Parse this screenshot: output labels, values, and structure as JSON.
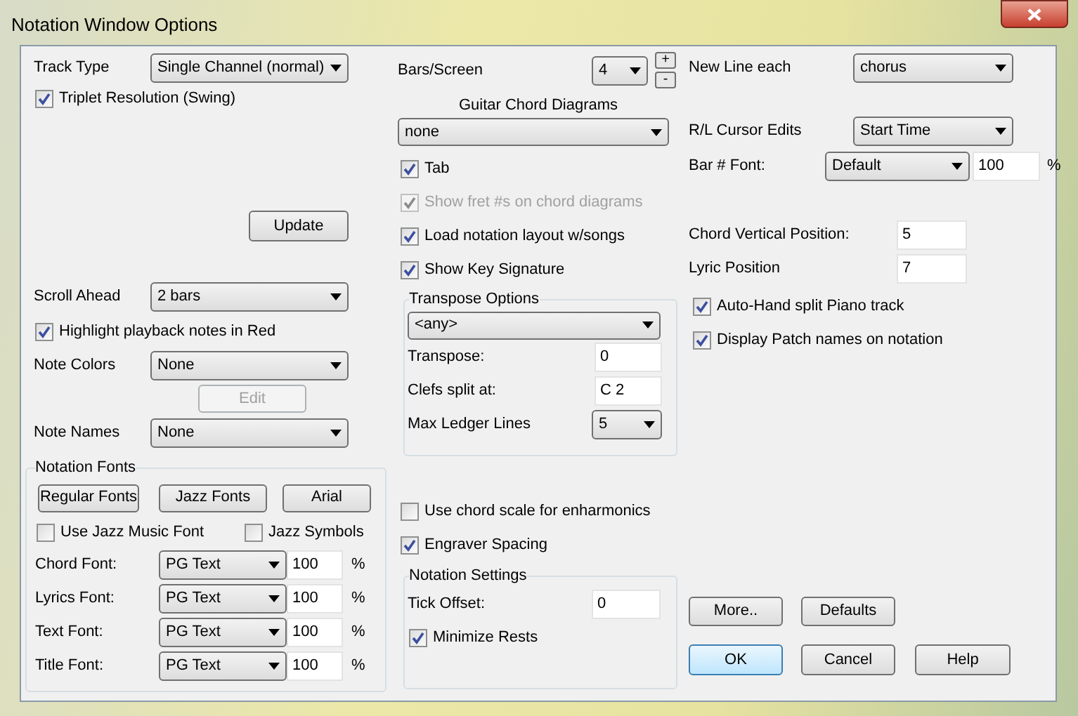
{
  "window": {
    "title": "Notation Window Options"
  },
  "track_type": {
    "label": "Track Type",
    "value": "Single Channel (normal)"
  },
  "triplet_resolution": {
    "label": "Triplet Resolution (Swing)",
    "checked": true
  },
  "update_button": "Update",
  "scroll_ahead": {
    "label": "Scroll Ahead",
    "value": "2 bars"
  },
  "highlight_playback": {
    "label": "Highlight playback notes in Red",
    "checked": true
  },
  "note_colors": {
    "label": "Note Colors",
    "value": "None"
  },
  "edit_button": {
    "label": "Edit",
    "disabled": true
  },
  "note_names": {
    "label": "Note Names",
    "value": "None"
  },
  "notation_fonts": {
    "title": "Notation Fonts",
    "buttons": [
      "Regular Fonts",
      "Jazz Fonts",
      "Arial"
    ],
    "use_jazz_music_font": {
      "label": "Use Jazz Music Font",
      "checked": false
    },
    "jazz_symbols": {
      "label": "Jazz Symbols",
      "checked": false
    },
    "fonts": [
      {
        "label": "Chord Font:",
        "value": "PG Text",
        "size": "100",
        "unit": "%"
      },
      {
        "label": "Lyrics Font:",
        "value": "PG Text",
        "size": "100",
        "unit": "%"
      },
      {
        "label": "Text Font:",
        "value": "PG Text",
        "size": "100",
        "unit": "%"
      },
      {
        "label": "Title Font:",
        "value": "PG Text",
        "size": "100",
        "unit": "%"
      }
    ]
  },
  "bars_screen": {
    "label": "Bars/Screen",
    "value": "4",
    "plus": "+",
    "minus": "-"
  },
  "guitar_chord_diagrams": {
    "label": "Guitar Chord Diagrams",
    "value": "none"
  },
  "middle_checks": [
    {
      "label": "Tab",
      "checked": true,
      "disabled": false
    },
    {
      "label": "Show fret #s on chord diagrams",
      "checked": true,
      "disabled": true
    },
    {
      "label": "Load notation layout w/songs",
      "checked": true,
      "disabled": false
    },
    {
      "label": "Show Key Signature",
      "checked": true,
      "disabled": false
    }
  ],
  "transpose_options": {
    "title": "Transpose Options",
    "value": "<any>",
    "transpose": {
      "label": "Transpose:",
      "value": "0"
    },
    "clefs_split": {
      "label": "Clefs split at:",
      "value": "C 2"
    },
    "max_ledger_lines": {
      "label": "Max Ledger Lines",
      "value": "5"
    }
  },
  "lower_checks": [
    {
      "label": "Use chord scale for enharmonics",
      "checked": false
    },
    {
      "label": "Engraver Spacing",
      "checked": true
    }
  ],
  "notation_settings": {
    "title": "Notation Settings",
    "tick_offset": {
      "label": "Tick Offset:",
      "value": "0"
    },
    "minimize_rests": {
      "label": "Minimize Rests",
      "checked": true
    }
  },
  "new_line_each": {
    "label": "New Line each",
    "value": "chorus"
  },
  "rl_cursor_edits": {
    "label": "R/L Cursor Edits",
    "value": "Start Time"
  },
  "bar_font": {
    "label": "Bar # Font:",
    "value": "Default",
    "size": "100",
    "unit": "%"
  },
  "chord_vertical_position": {
    "label": "Chord Vertical Position:",
    "value": "5"
  },
  "lyric_position": {
    "label": "Lyric Position",
    "value": "7"
  },
  "right_checks": [
    {
      "label": "Auto-Hand split Piano track",
      "checked": true
    },
    {
      "label": "Display Patch names on notation",
      "checked": true
    }
  ],
  "buttons": [
    {
      "label": "More..",
      "default": false
    },
    {
      "label": "Defaults",
      "default": false
    }
  ],
  "dialog_buttons": [
    {
      "label": "OK",
      "default": true
    },
    {
      "label": "Cancel",
      "default": false
    },
    {
      "label": "Help",
      "default": false
    }
  ]
}
